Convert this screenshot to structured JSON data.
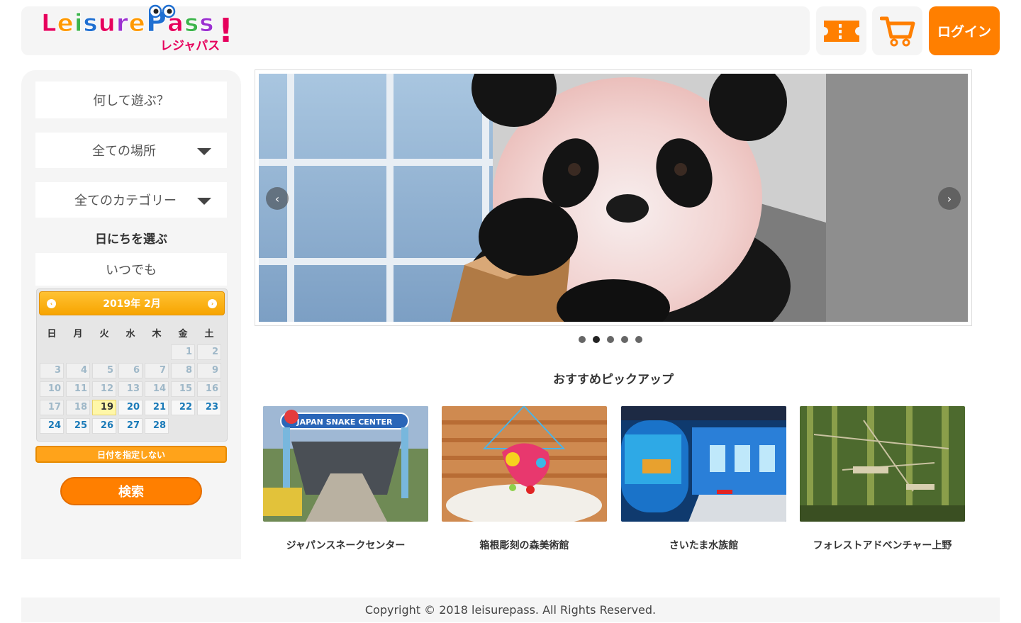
{
  "header": {
    "logo_text_parts": [
      "L",
      "e",
      "i",
      "s",
      "u",
      "r",
      "e",
      "P",
      "a",
      "s",
      "s"
    ],
    "logo_sub": "レジャパス",
    "logo_bang": "!",
    "login_label": "ログイン",
    "ticket_icon": "ticket-icon",
    "cart_icon": "cart-icon",
    "accent_color": "#ff7f00"
  },
  "sidebar": {
    "activity_placeholder": "何して遊ぶ？",
    "place_select": "全ての場所",
    "category_select": "全てのカテゴリー",
    "date_heading": "日にちを選ぶ",
    "date_value": "いつでも",
    "no_date_label": "日付を指定しない",
    "search_label": "検索"
  },
  "calendar": {
    "title": "2019年 2月",
    "prev_icon": "‹",
    "next_icon": "›",
    "weekdays": [
      "日",
      "月",
      "火",
      "水",
      "木",
      "金",
      "土"
    ],
    "today": "19",
    "weeks": [
      [
        "",
        "",
        "",
        "",
        "",
        "1",
        "2"
      ],
      [
        "3",
        "4",
        "5",
        "6",
        "7",
        "8",
        "9"
      ],
      [
        "10",
        "11",
        "12",
        "13",
        "14",
        "15",
        "16"
      ],
      [
        "17",
        "18",
        "19",
        "20",
        "21",
        "22",
        "23"
      ],
      [
        "24",
        "25",
        "26",
        "27",
        "28",
        "",
        ""
      ]
    ]
  },
  "carousel": {
    "slide_count": 5,
    "active_index": 1,
    "prev_icon": "‹",
    "next_icon": "›"
  },
  "picks": {
    "heading": "おすすめピックアップ",
    "items": [
      {
        "title": "ジャパンスネークセンター",
        "sign_text": "JAPAN SNAKE CENTER"
      },
      {
        "title": "箱根彫刻の森美術館"
      },
      {
        "title": "さいたま水族館"
      },
      {
        "title": "フォレストアドベンチャー上野"
      }
    ]
  },
  "footer": {
    "copyright": "Copyright © 2018 leisurepass. All Rights Reserved."
  }
}
